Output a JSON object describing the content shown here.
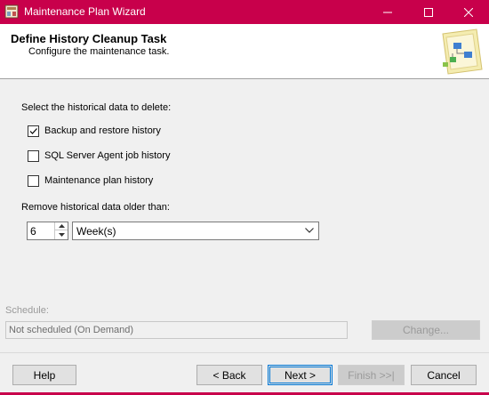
{
  "window": {
    "title": "Maintenance Plan Wizard",
    "accent_color": "#c8004b",
    "controls": [
      "minimize-icon",
      "maximize-icon",
      "close-icon"
    ]
  },
  "header": {
    "title": "Define History Cleanup Task",
    "subtitle": "Configure the maintenance task."
  },
  "form": {
    "select_label": "Select the historical data to delete:",
    "options": [
      {
        "label": "Backup and restore history",
        "checked": true
      },
      {
        "label": "SQL Server Agent job history",
        "checked": false
      },
      {
        "label": "Maintenance plan history",
        "checked": false
      }
    ],
    "older_than_label": "Remove historical data older than:",
    "older_than_value": "6",
    "unit_value": "Week(s)"
  },
  "schedule": {
    "label": "Schedule:",
    "value": "Not scheduled (On Demand)",
    "change_label": "Change..."
  },
  "buttons": {
    "help": "Help",
    "back": "< Back",
    "next": "Next >",
    "finish": "Finish >>|",
    "cancel": "Cancel"
  }
}
